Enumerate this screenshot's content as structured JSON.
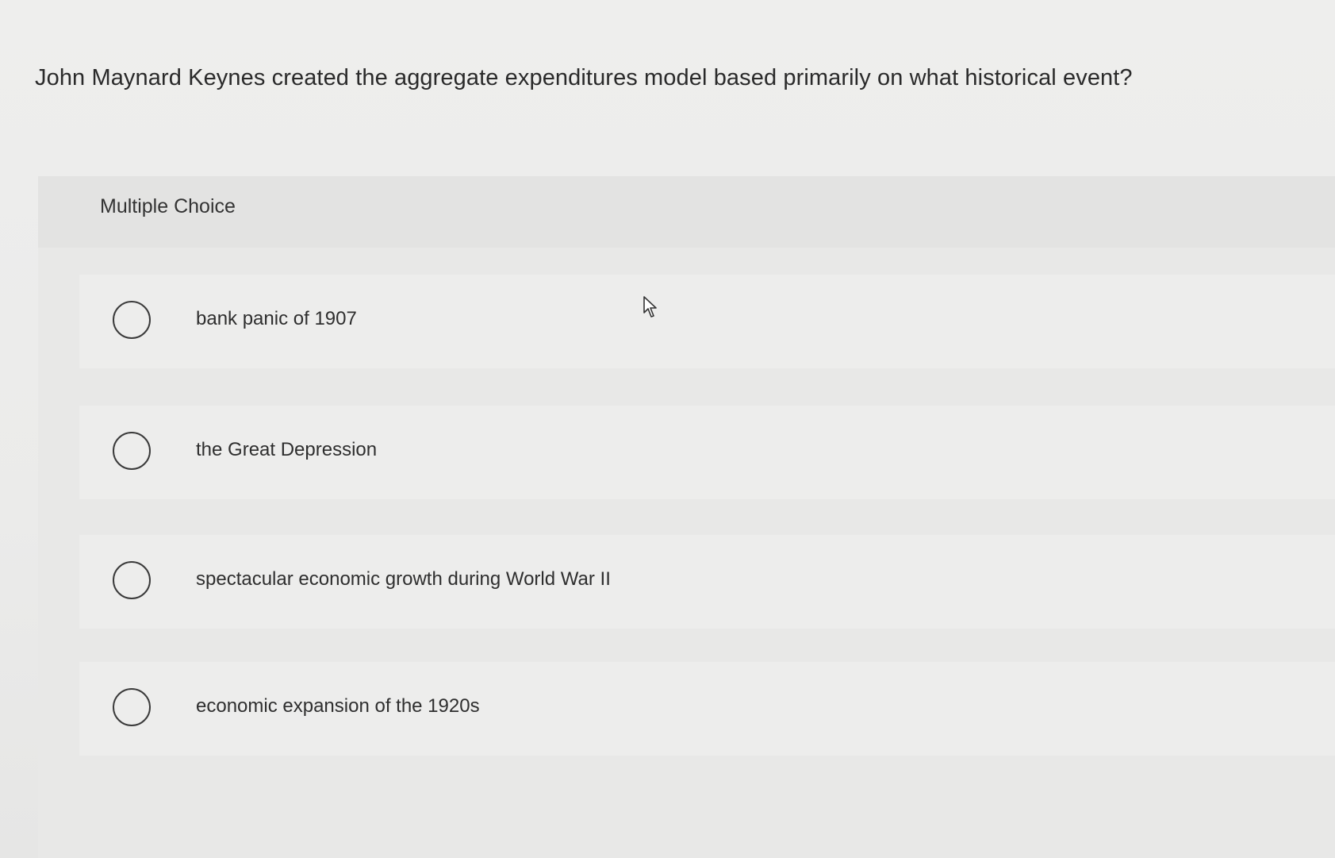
{
  "question": {
    "text": "John Maynard Keynes created the aggregate expenditures model based primarily on what historical event?"
  },
  "multiple_choice": {
    "label": "Multiple Choice",
    "options": [
      {
        "label": "bank panic of 1907",
        "selected": false
      },
      {
        "label": "the Great Depression",
        "selected": false
      },
      {
        "label": "spectacular economic growth during World War II",
        "selected": false
      },
      {
        "label": "economic expansion of the 1920s",
        "selected": false
      }
    ]
  },
  "icons": {
    "cursor": "pointer-cursor-icon",
    "radio": "radio-button-icon"
  },
  "colors": {
    "background": "#ececeb",
    "panel": "#e5e5e4",
    "option_background": "#ededec",
    "text": "#2a2a2a"
  }
}
